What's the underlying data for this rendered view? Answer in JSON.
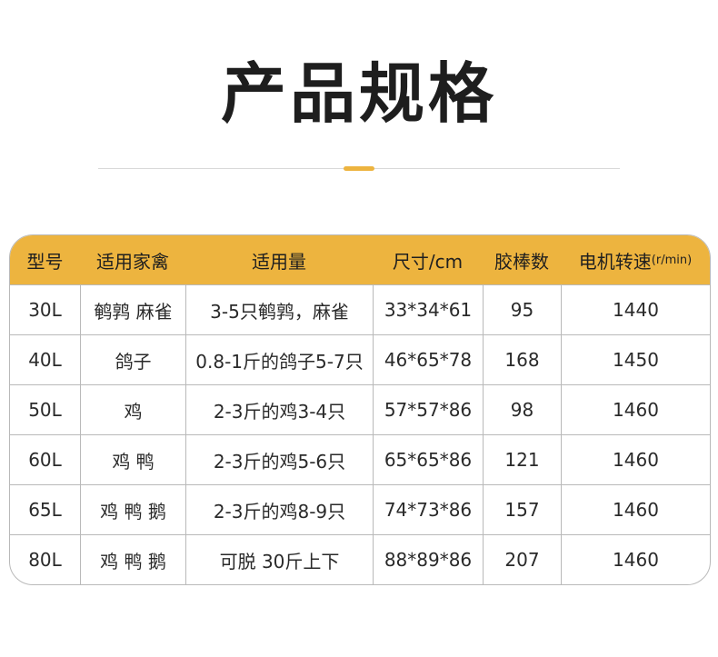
{
  "title": "产品规格",
  "colors": {
    "accent": "#EDB43F",
    "header_bg": "#EDB43F",
    "border": "#B9B9B9",
    "divider": "#D9D9D9"
  },
  "table": {
    "headers": [
      "型号",
      "适用家禽",
      "适用量",
      "尺寸/cm",
      "胶棒数",
      "电机转速"
    ],
    "header_unit": "(r/min)",
    "rows": [
      [
        "30L",
        "鹌鹑 麻雀",
        "3-5只鹌鹑，麻雀",
        "33*34*61",
        "95",
        "1440"
      ],
      [
        "40L",
        "鸽子",
        "0.8-1斤的鸽子5-7只",
        "46*65*78",
        "168",
        "1450"
      ],
      [
        "50L",
        "鸡",
        "2-3斤的鸡3-4只",
        "57*57*86",
        "98",
        "1460"
      ],
      [
        "60L",
        "鸡 鸭",
        "2-3斤的鸡5-6只",
        "65*65*86",
        "121",
        "1460"
      ],
      [
        "65L",
        "鸡 鸭 鹅",
        "2-3斤的鸡8-9只",
        "74*73*86",
        "157",
        "1460"
      ],
      [
        "80L",
        "鸡 鸭 鹅",
        "可脱 30斤上下",
        "88*89*86",
        "207",
        "1460"
      ]
    ]
  }
}
